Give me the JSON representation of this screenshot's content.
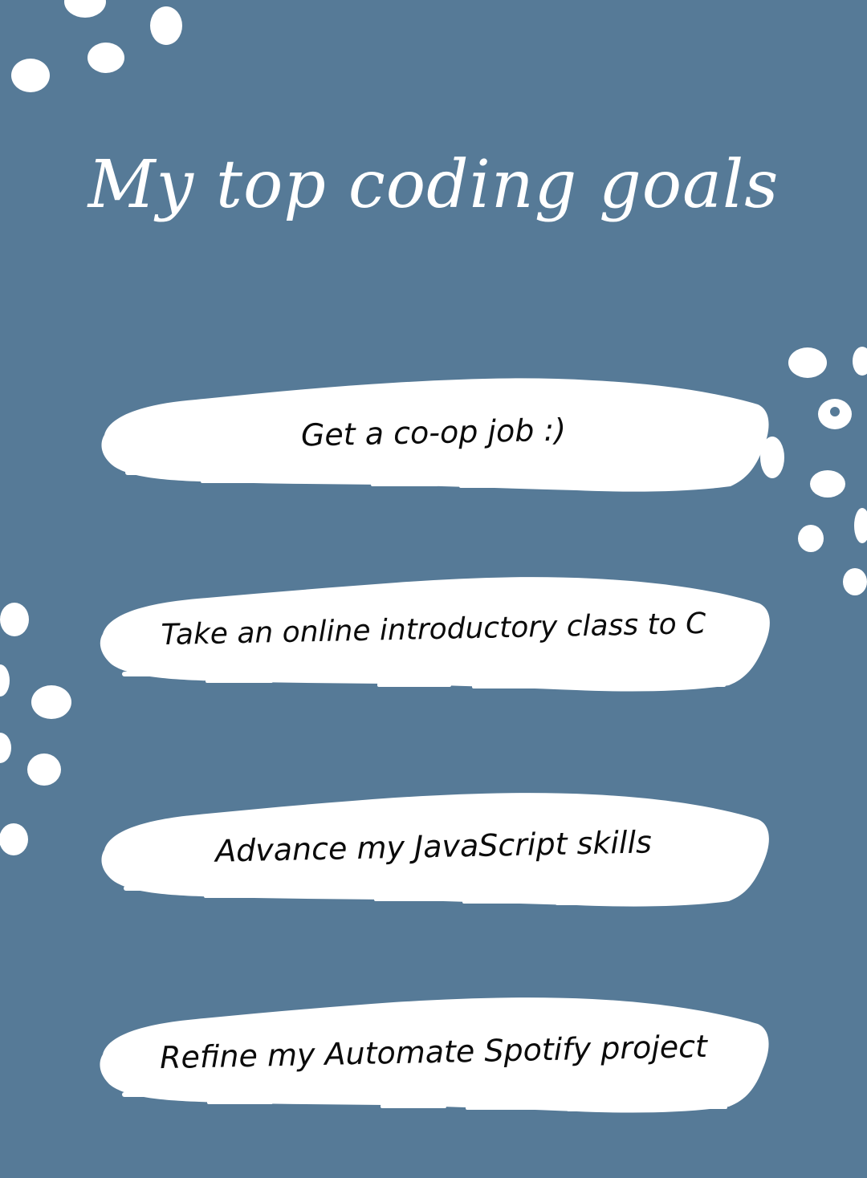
{
  "title": "My top coding goals",
  "goals": [
    {
      "label": "Get a co-op job :)"
    },
    {
      "label": "Take an online introductory class to C"
    },
    {
      "label": "Advance my JavaScript skills"
    },
    {
      "label": "Refine my Automate Spotify project"
    }
  ],
  "colors": {
    "background": "#567a97",
    "accent": "#ffffff",
    "text": "#0b0b0b"
  }
}
